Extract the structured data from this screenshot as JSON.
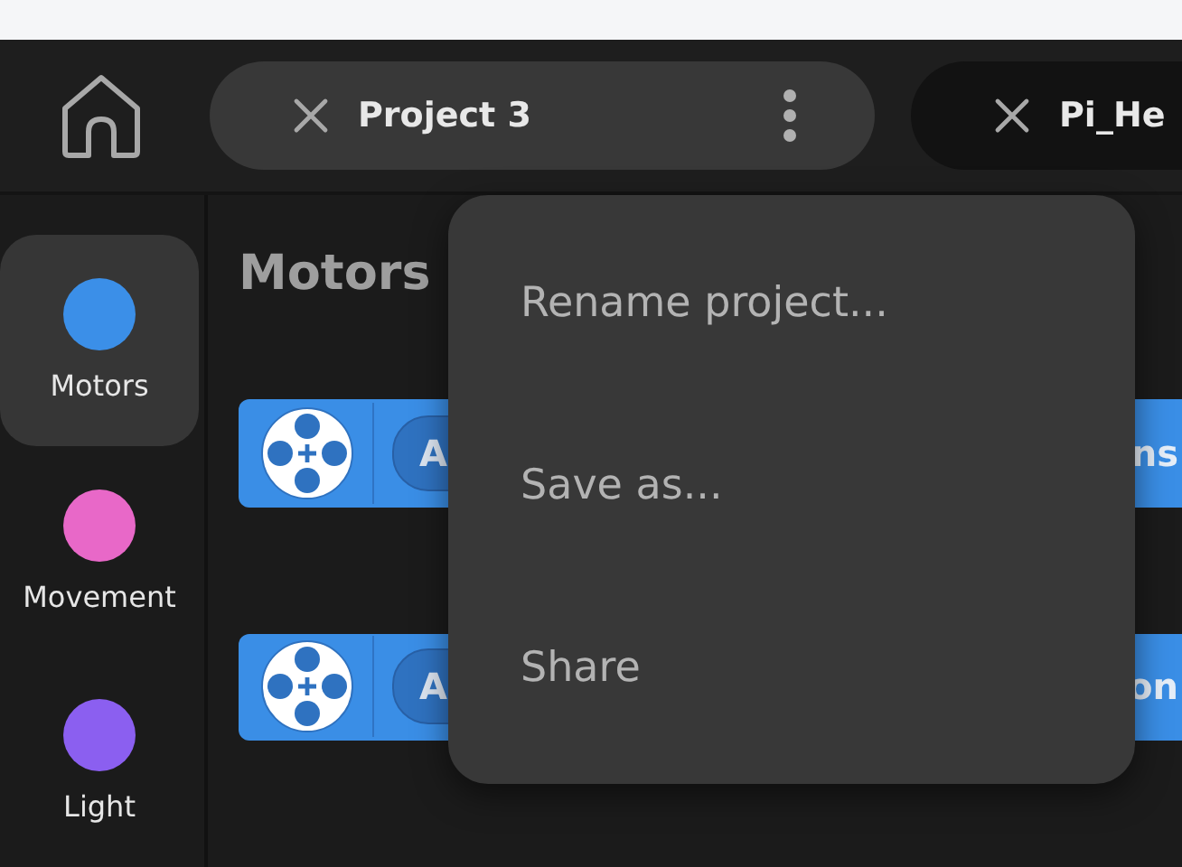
{
  "tabs": [
    {
      "label": "Project 3",
      "selected": true,
      "has_menu": true
    },
    {
      "label": "Pi_He",
      "selected": false,
      "has_menu": false
    }
  ],
  "sidebar": {
    "items": [
      {
        "label": "Motors",
        "color": "#3b8fe8",
        "selected": true
      },
      {
        "label": "Movement",
        "color": "#e868c8",
        "selected": false
      },
      {
        "label": "Light",
        "color": "#8b5ff0",
        "selected": false
      }
    ]
  },
  "palette": {
    "title": "Motors",
    "blocks": [
      {
        "field": "A",
        "label": "ns"
      },
      {
        "field": "A",
        "label": "on"
      }
    ]
  },
  "menu": {
    "items": [
      "Rename project...",
      "Save as...",
      "Share"
    ]
  }
}
